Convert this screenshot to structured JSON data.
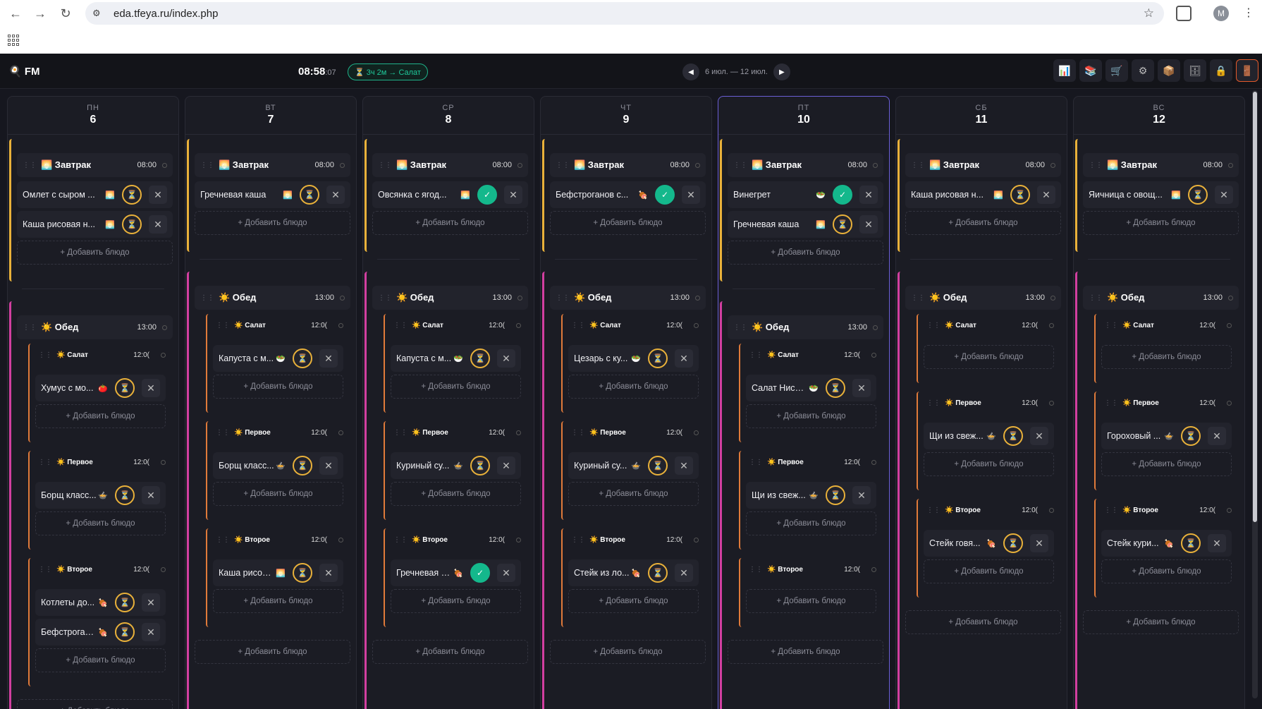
{
  "browser": {
    "url": "eda.tfeya.ru/index.php",
    "profile_initial": "M"
  },
  "app": {
    "logo": "🍳 FM",
    "clock_main": "08:58",
    "clock_sec": ":07",
    "next_meal": "⏳ 3ч 2м → Салат",
    "week_label": "6 июл. — 12 июл.",
    "tools": [
      "📊",
      "📚",
      "🛒",
      "⚙",
      "📦",
      "🗄",
      "🔒",
      "🚪"
    ]
  },
  "labels": {
    "add_dish": "+ Добавить блюдо",
    "breakfast": "🌅 Завтрак",
    "breakfast_time": "08:00",
    "lunch": "☀️ Обед",
    "lunch_time": "13:00",
    "salad": "☀️ Салат",
    "first": "☀️ Первое",
    "second": "☀️ Второе",
    "sub_time": "12:0("
  },
  "days": [
    {
      "dow": "ПН",
      "num": "6",
      "breakfast": [
        {
          "name": "Омлет с сыром ...",
          "icon": "🌅",
          "status": "pending"
        },
        {
          "name": "Каша рисовая н...",
          "icon": "🌅",
          "status": "pending"
        }
      ],
      "salad": [
        {
          "name": "Хумус с мо...",
          "icon": "🍅",
          "status": "pending"
        }
      ],
      "first": [
        {
          "name": "Борщ класс...",
          "icon": "🍲",
          "status": "pending"
        }
      ],
      "second": [
        {
          "name": "Котлеты до...",
          "icon": "🍖",
          "status": "pending"
        },
        {
          "name": "Бефстроган...",
          "icon": "🍖",
          "status": "pending"
        }
      ]
    },
    {
      "dow": "ВТ",
      "num": "7",
      "breakfast": [
        {
          "name": "Гречневая каша",
          "icon": "🌅",
          "status": "pending"
        }
      ],
      "salad": [
        {
          "name": "Капуста с м...",
          "icon": "🥗",
          "status": "pending"
        }
      ],
      "first": [
        {
          "name": "Борщ класс...",
          "icon": "🍲",
          "status": "pending"
        }
      ],
      "second": [
        {
          "name": "Каша рисов...",
          "icon": "🌅",
          "status": "pending"
        }
      ]
    },
    {
      "dow": "СР",
      "num": "8",
      "breakfast": [
        {
          "name": "Овсянка с ягод...",
          "icon": "🌅",
          "status": "done"
        }
      ],
      "salad": [
        {
          "name": "Капуста с м...",
          "icon": "🥗",
          "status": "pending"
        }
      ],
      "first": [
        {
          "name": "Куриный су...",
          "icon": "🍲",
          "status": "pending"
        }
      ],
      "second": [
        {
          "name": "Гречневая к...",
          "icon": "🍖",
          "status": "done"
        }
      ]
    },
    {
      "dow": "ЧТ",
      "num": "9",
      "breakfast": [
        {
          "name": "Бефстроганов с...",
          "icon": "🍖",
          "status": "done"
        }
      ],
      "salad": [
        {
          "name": "Цезарь с ку...",
          "icon": "🥗",
          "status": "pending"
        }
      ],
      "first": [
        {
          "name": "Куриный су...",
          "icon": "🍲",
          "status": "pending"
        }
      ],
      "second": [
        {
          "name": "Стейк из ло...",
          "icon": "🍖",
          "status": "pending"
        }
      ]
    },
    {
      "dow": "ПТ",
      "num": "10",
      "breakfast": [
        {
          "name": "Винегрет",
          "icon": "🥗",
          "status": "done"
        },
        {
          "name": "Гречневая каша",
          "icon": "🌅",
          "status": "pending"
        }
      ],
      "salad": [
        {
          "name": "Салат Нисуаз",
          "icon": "🥗",
          "status": "pending"
        }
      ],
      "first": [
        {
          "name": "Щи из свеж...",
          "icon": "🍲",
          "status": "pending"
        }
      ],
      "second": []
    },
    {
      "dow": "СБ",
      "num": "11",
      "breakfast": [
        {
          "name": "Каша рисовая н...",
          "icon": "🌅",
          "status": "pending"
        }
      ],
      "salad": [],
      "first": [
        {
          "name": "Щи из свеж...",
          "icon": "🍲",
          "status": "pending"
        }
      ],
      "second": [
        {
          "name": "Стейк говя...",
          "icon": "🍖",
          "status": "pending"
        }
      ]
    },
    {
      "dow": "ВС",
      "num": "12",
      "breakfast": [
        {
          "name": "Яичница с овощ...",
          "icon": "🌅",
          "status": "pending"
        }
      ],
      "salad": [],
      "first": [
        {
          "name": "Гороховый ...",
          "icon": "🍲",
          "status": "pending"
        }
      ],
      "second": [
        {
          "name": "Стейк кури...",
          "icon": "🍖",
          "status": "pending"
        }
      ]
    }
  ],
  "today_index": 4,
  "colors": {
    "accent": "#e9b13a",
    "done": "#14b88c",
    "lunch": "#d23fa0",
    "sub": "#e07a3a",
    "today": "#6b5fd6"
  }
}
